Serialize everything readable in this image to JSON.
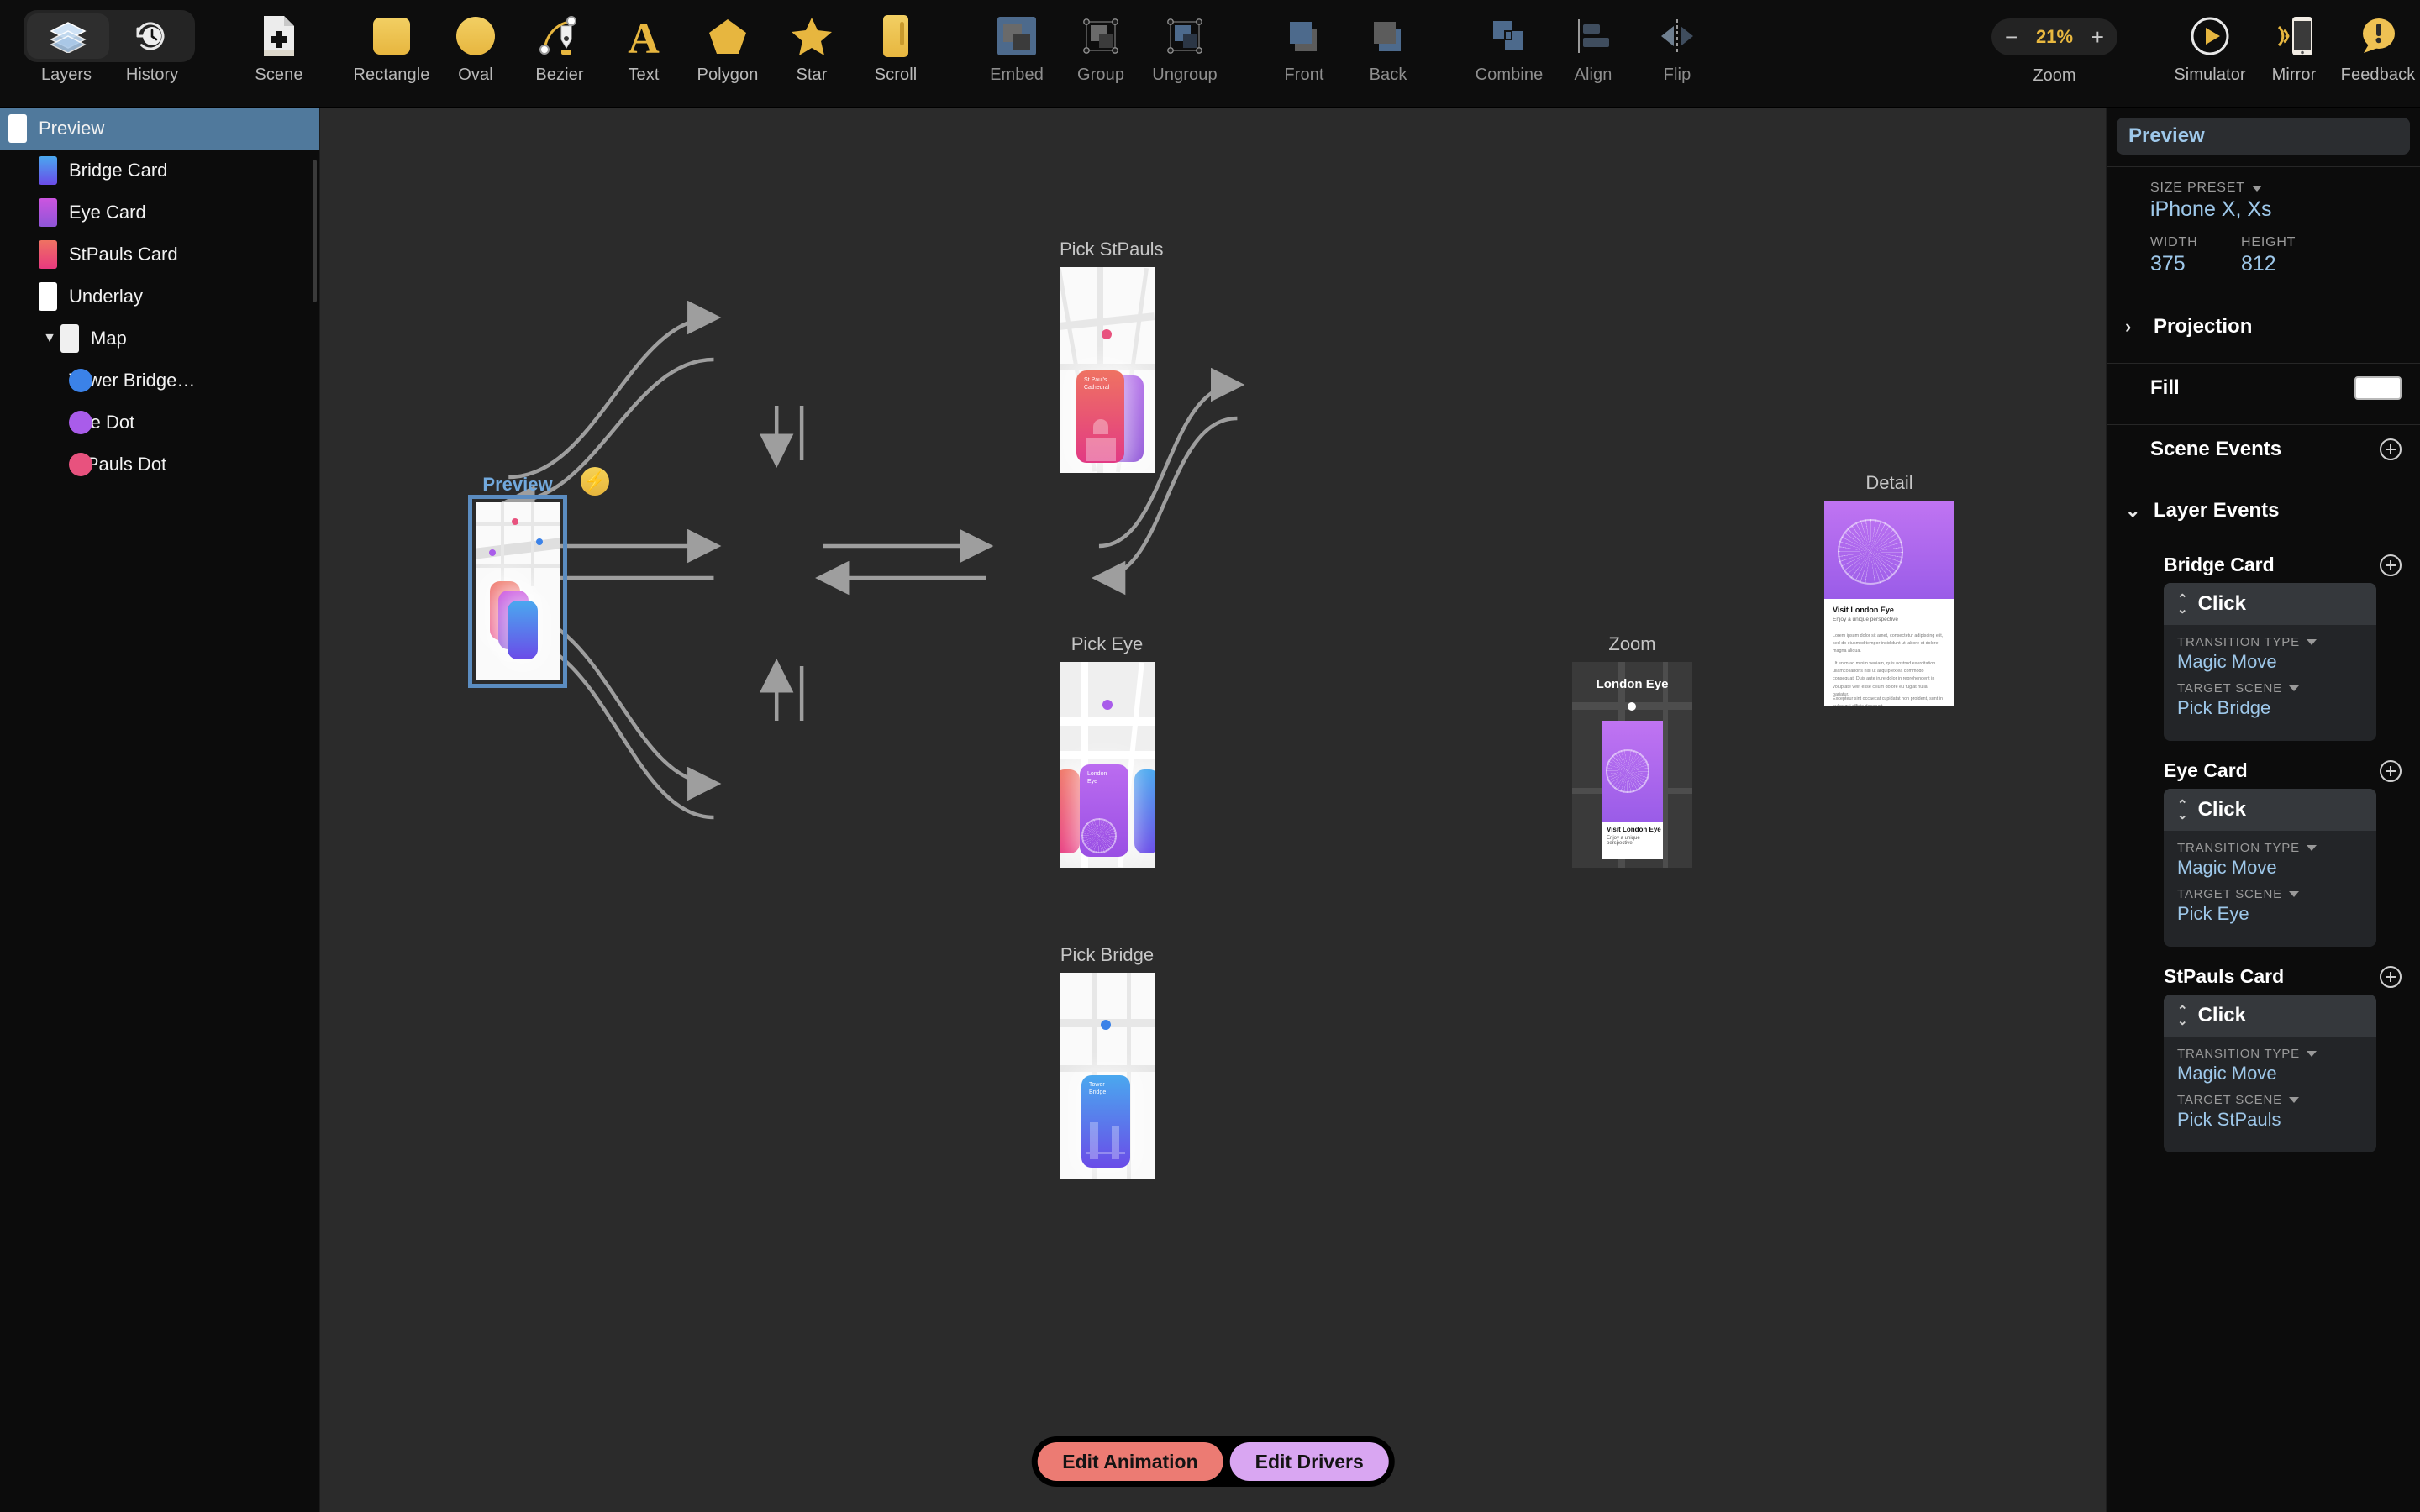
{
  "toolbar": {
    "left_segment": [
      {
        "label": "Layers",
        "icon": "layers-icon",
        "active": true
      },
      {
        "label": "History",
        "icon": "history-clock-icon",
        "active": false
      }
    ],
    "scene": {
      "label": "Scene",
      "icon": "new-scene-icon"
    },
    "shapes": [
      {
        "label": "Rectangle",
        "icon": "rectangle-icon"
      },
      {
        "label": "Oval",
        "icon": "oval-icon"
      },
      {
        "label": "Bezier",
        "icon": "bezier-pen-icon"
      },
      {
        "label": "Text",
        "icon": "text-icon"
      },
      {
        "label": "Polygon",
        "icon": "polygon-icon"
      },
      {
        "label": "Star",
        "icon": "star-icon"
      },
      {
        "label": "Scroll",
        "icon": "scroll-icon"
      }
    ],
    "grouping": [
      {
        "label": "Embed",
        "icon": "embed-icon"
      },
      {
        "label": "Group",
        "icon": "group-icon"
      },
      {
        "label": "Ungroup",
        "icon": "ungroup-icon"
      }
    ],
    "arrange": [
      {
        "label": "Front",
        "icon": "bring-front-icon"
      },
      {
        "label": "Back",
        "icon": "send-back-icon"
      }
    ],
    "ops": [
      {
        "label": "Combine",
        "icon": "combine-icon"
      },
      {
        "label": "Align",
        "icon": "align-icon"
      },
      {
        "label": "Flip",
        "icon": "flip-icon"
      }
    ],
    "zoom": {
      "label": "Zoom",
      "value": "21%",
      "minus": "−",
      "plus": "+"
    },
    "right": [
      {
        "label": "Simulator",
        "icon": "play-circle-icon"
      },
      {
        "label": "Mirror",
        "icon": "phone-mirror-icon"
      },
      {
        "label": "Feedback",
        "icon": "feedback-bubble-icon"
      }
    ]
  },
  "sidebar": {
    "layers": [
      {
        "name": "Preview",
        "indent": 0,
        "selected": true,
        "thumb": "white",
        "twisty": ""
      },
      {
        "name": "Bridge Card",
        "indent": 1,
        "selected": false,
        "thumb": "blue",
        "twisty": ""
      },
      {
        "name": "Eye Card",
        "indent": 1,
        "selected": false,
        "thumb": "purple",
        "twisty": ""
      },
      {
        "name": "StPauls Card",
        "indent": 1,
        "selected": false,
        "thumb": "red",
        "twisty": ""
      },
      {
        "name": "Underlay",
        "indent": 1,
        "selected": false,
        "thumb": "white",
        "twisty": ""
      },
      {
        "name": "Map",
        "indent": 1,
        "selected": false,
        "thumb": "map",
        "twisty": "▼"
      },
      {
        "name": "Tower Bridge…",
        "indent": 2,
        "selected": false,
        "thumb": "dot-blue",
        "twisty": ""
      },
      {
        "name": "Eye Dot",
        "indent": 2,
        "selected": false,
        "thumb": "dot-purple",
        "twisty": ""
      },
      {
        "name": "StPauls Dot",
        "indent": 2,
        "selected": false,
        "thumb": "dot-pink",
        "twisty": ""
      }
    ]
  },
  "canvas": {
    "boards": [
      {
        "id": "pick-stpauls",
        "caption": "Pick StPauls",
        "selected": false
      },
      {
        "id": "preview",
        "caption": "Preview",
        "selected": true
      },
      {
        "id": "pick-eye",
        "caption": "Pick Eye",
        "selected": false
      },
      {
        "id": "pick-bridge",
        "caption": "Pick Bridge",
        "selected": false
      },
      {
        "id": "zoom",
        "caption": "Zoom",
        "selected": false
      },
      {
        "id": "detail",
        "caption": "Detail",
        "selected": false
      }
    ],
    "cards": {
      "stpauls_title": "St Paul's\nCathedral",
      "eye_title": "London\nEye",
      "bridge_title": "Tower\nBridge",
      "zoom_header": "London Eye",
      "cta_title": "Visit London Eye",
      "cta_sub": "Enjoy a unique perspective",
      "detail_p1": "Lorem ipsum dolor sit amet, consectetur adipiscing elit, sed do eiusmod tempor incididunt ut labore et dolore magna aliqua.",
      "detail_p2": "Ut enim ad minim veniam, quis nostrud exercitation ullamco laboris nisi ut aliquip ex ea commodo consequat. Duis aute irure dolor in reprehenderit in voluptate velit esse cillum dolore eu fugiat nulla pariatur.",
      "detail_p3": "Excepteur sint occaecat cupidatat non proident, sunt in culpa qui officia deserunt"
    },
    "bottom_buttons": [
      {
        "label": "Edit Animation",
        "color": "#ec7b73"
      },
      {
        "label": "Edit Drivers",
        "color": "#d9a6f2"
      }
    ]
  },
  "inspector": {
    "title": "Preview",
    "size_preset_label": "SIZE PRESET",
    "size_preset_value": "iPhone X, Xs",
    "width_label": "WIDTH",
    "width_value": "375",
    "height_label": "HEIGHT",
    "height_value": "812",
    "projection_label": "Projection",
    "fill_label": "Fill",
    "fill_color": "#ffffff",
    "scene_events_label": "Scene Events",
    "layer_events_label": "Layer Events",
    "layer_events": [
      {
        "layer": "Bridge Card",
        "event": "Click",
        "transition_label": "TRANSITION TYPE",
        "transition_value": "Magic Move",
        "target_label": "TARGET SCENE",
        "target_value": "Pick Bridge"
      },
      {
        "layer": "Eye Card",
        "event": "Click",
        "transition_label": "TRANSITION TYPE",
        "transition_value": "Magic Move",
        "target_label": "TARGET SCENE",
        "target_value": "Pick Eye"
      },
      {
        "layer": "StPauls Card",
        "event": "Click",
        "transition_label": "TRANSITION TYPE",
        "transition_value": "Magic Move",
        "target_label": "TARGET SCENE",
        "target_value": "Pick StPauls"
      }
    ]
  },
  "colors": {
    "accent_blue": "#9ec8ea",
    "selection_blue": "#50799c",
    "yellow": "#e9b83f",
    "pink": "#e8527e",
    "purple": "#a95cea",
    "blue_dot": "#3b82e8"
  }
}
